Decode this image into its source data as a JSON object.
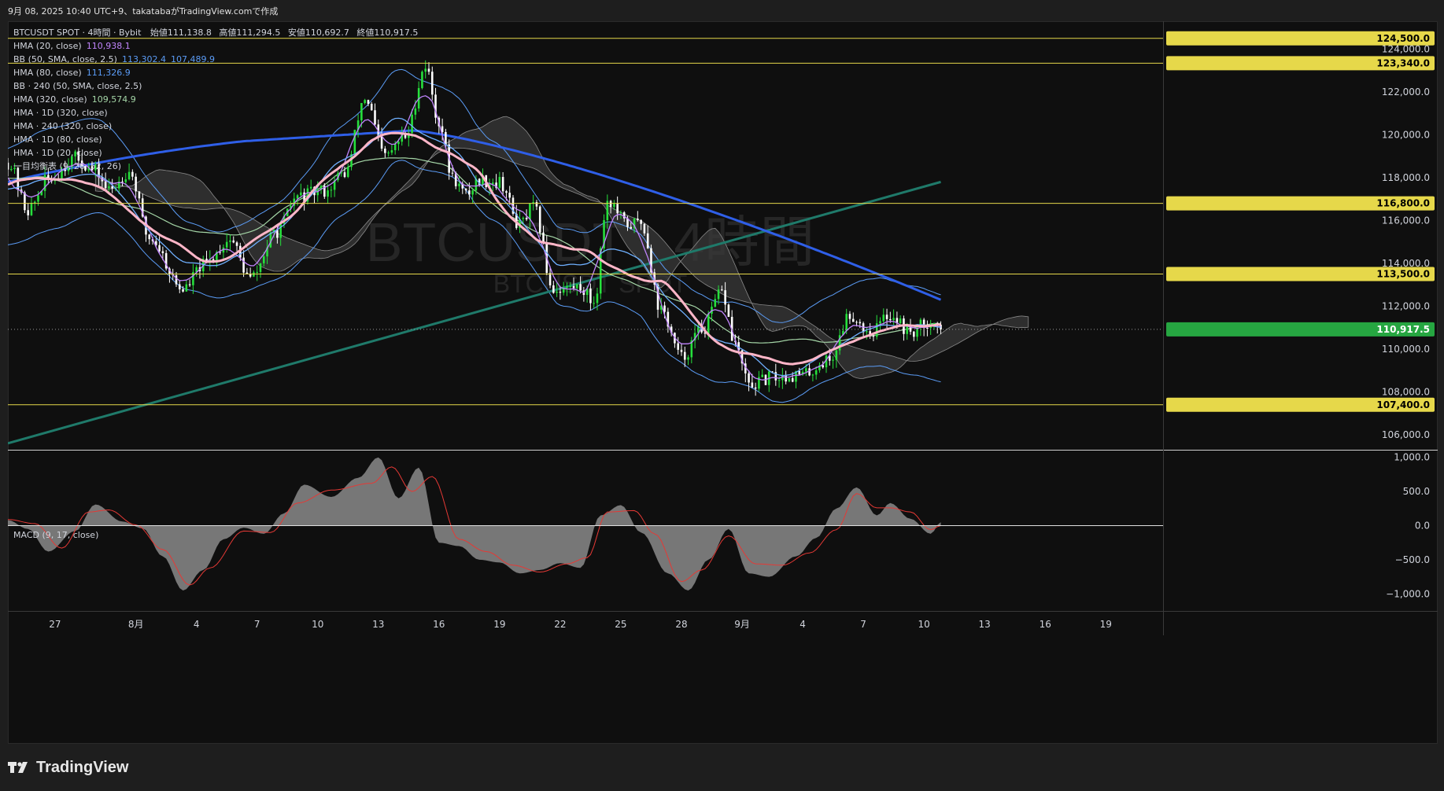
{
  "header": {
    "snapshot_text": "9月 08, 2025 10:40 UTC+9、takatabaがTradingView.comで作成",
    "symbol_line": {
      "symbol": "BTCUSDT SPOT · 4時間 · Bybit",
      "open_label": "始値",
      "open": "111,138.8",
      "high_label": "高値",
      "high": "111,294.5",
      "low_label": "安値",
      "low": "110,692.7",
      "close_label": "終値",
      "close": "110,917.5"
    }
  },
  "watermark": {
    "main": "BTCUSDT · 4時間",
    "sub": "BTCUSDT SPOT"
  },
  "indicators": [
    {
      "name": "HMA (20, close)",
      "value": "110,938.1",
      "value_color": "#c084fc"
    },
    {
      "name": "BB (50, SMA, close, 2.5)",
      "value": "113,302.4",
      "value2": "107,489.9",
      "value_color": "#5b9cf6"
    },
    {
      "name": "HMA (80, close)",
      "value": "111,326.9",
      "value_color": "#5b9cf6"
    },
    {
      "name": "BB · 240 (50, SMA, close, 2.5)",
      "value": "",
      "value_color": "#9e9e9e"
    },
    {
      "name": "HMA (320, close)",
      "value": "109,574.9",
      "value_color": "#a5d6a7"
    },
    {
      "name": "HMA · 1D (320, close)",
      "value": "",
      "value_color": "#9e9e9e"
    },
    {
      "name": "HMA · 240 (320, close)",
      "value": "",
      "value_color": "#9e9e9e"
    },
    {
      "name": "HMA · 1D (80, close)",
      "value": "",
      "value_color": "#9e9e9e"
    },
    {
      "name": "HMA · 1D (20, close)",
      "value": "",
      "value_color": "#9e9e9e"
    },
    {
      "name": "一目均衡表 (9, 26, 52, 26)",
      "value": "",
      "value_color": "#9e9e9e"
    }
  ],
  "macd_legend": "MACD (9, 17, close)",
  "footer": {
    "brand": "TradingView"
  },
  "colors": {
    "up": "#26e03c",
    "down": "#ffffff",
    "hline": "#e6d84a",
    "hma20": "#c084fc",
    "bb": "#5b9cf6",
    "hma80": "#6fb0ff",
    "hma320": "#a5d6a7",
    "hma1d80": "#2f5fe8",
    "hma240": "#ffb6c8",
    "trend": "#1f7a6a",
    "cloud": "#3a3a3a",
    "macd_hist": "#8a8a8a",
    "signal": "#e53935",
    "last_price_bg": "#26a641"
  },
  "chart_data": {
    "type": "candlestick",
    "title": "BTCUSDT SPOT · 4時間 · Bybit",
    "ylim": [
      105300,
      125300
    ],
    "yticks": [
      106000,
      108000,
      110000,
      112000,
      114000,
      116000,
      118000,
      120000,
      122000,
      124000
    ],
    "ytick_labels": [
      "106,000.0",
      "108,000.0",
      "110,000.0",
      "112,000.0",
      "114,000.0",
      "116,000.0",
      "118,000.0",
      "120,000.0",
      "122,000.0",
      "124,000.0"
    ],
    "horizontal_levels": [
      {
        "value": 124500,
        "label": "124,500.0"
      },
      {
        "value": 123340,
        "label": "123,340.0"
      },
      {
        "value": 116800,
        "label": "116,800.0"
      },
      {
        "value": 113500,
        "label": "113,500.0"
      },
      {
        "value": 107400,
        "label": "107,400.0"
      }
    ],
    "last_price": {
      "value": 110917.5,
      "label": "110,917.5"
    },
    "x_ticks": [
      {
        "label": "27",
        "bar": 14
      },
      {
        "label": "8月",
        "bar": 38
      },
      {
        "label": "4",
        "bar": 56
      },
      {
        "label": "7",
        "bar": 74
      },
      {
        "label": "10",
        "bar": 92
      },
      {
        "label": "13",
        "bar": 110
      },
      {
        "label": "16",
        "bar": 128
      },
      {
        "label": "19",
        "bar": 146
      },
      {
        "label": "22",
        "bar": 164
      },
      {
        "label": "25",
        "bar": 182
      },
      {
        "label": "28",
        "bar": 200
      },
      {
        "label": "9月",
        "bar": 218
      },
      {
        "label": "4",
        "bar": 236
      },
      {
        "label": "7",
        "bar": 254
      },
      {
        "label": "10",
        "bar": 272
      },
      {
        "label": "13",
        "bar": 290
      },
      {
        "label": "16",
        "bar": 308
      },
      {
        "label": "19",
        "bar": 326
      }
    ],
    "x_range": [
      0,
      343
    ],
    "close_anchors": [
      [
        0,
        118700
      ],
      [
        6,
        116500
      ],
      [
        12,
        117900
      ],
      [
        20,
        118900
      ],
      [
        26,
        118300
      ],
      [
        30,
        117400
      ],
      [
        36,
        118300
      ],
      [
        42,
        115200
      ],
      [
        52,
        112800
      ],
      [
        58,
        113900
      ],
      [
        66,
        115100
      ],
      [
        72,
        113300
      ],
      [
        80,
        115500
      ],
      [
        86,
        117100
      ],
      [
        94,
        117400
      ],
      [
        100,
        118200
      ],
      [
        106,
        121700
      ],
      [
        112,
        119000
      ],
      [
        118,
        119900
      ],
      [
        124,
        123200
      ],
      [
        128,
        120600
      ],
      [
        132,
        118000
      ],
      [
        136,
        117200
      ],
      [
        140,
        117900
      ],
      [
        146,
        117800
      ],
      [
        152,
        115800
      ],
      [
        156,
        116600
      ],
      [
        162,
        112800
      ],
      [
        170,
        112900
      ],
      [
        174,
        112200
      ],
      [
        178,
        116900
      ],
      [
        184,
        115800
      ],
      [
        188,
        115900
      ],
      [
        194,
        111800
      ],
      [
        200,
        109600
      ],
      [
        206,
        110900
      ],
      [
        212,
        112600
      ],
      [
        216,
        110200
      ],
      [
        220,
        108300
      ],
      [
        228,
        108700
      ],
      [
        236,
        108800
      ],
      [
        244,
        109500
      ],
      [
        250,
        111600
      ],
      [
        256,
        110800
      ],
      [
        262,
        111600
      ],
      [
        268,
        110800
      ],
      [
        274,
        111300
      ],
      [
        277,
        110917.5
      ]
    ],
    "macd": {
      "ylim": [
        -1250,
        1100
      ],
      "yticks": [
        1000,
        500,
        0,
        -500,
        -1000
      ],
      "ytick_labels": [
        "1,000.0",
        "500.0",
        "0.0",
        "−500.0",
        "−1,000.0"
      ],
      "hist_anchors": [
        [
          0,
          80
        ],
        [
          6,
          -50
        ],
        [
          12,
          -380
        ],
        [
          20,
          -80
        ],
        [
          26,
          310
        ],
        [
          34,
          60
        ],
        [
          40,
          -40
        ],
        [
          46,
          -450
        ],
        [
          52,
          -950
        ],
        [
          58,
          -650
        ],
        [
          64,
          -200
        ],
        [
          70,
          -30
        ],
        [
          76,
          -120
        ],
        [
          82,
          180
        ],
        [
          88,
          600
        ],
        [
          96,
          420
        ],
        [
          104,
          700
        ],
        [
          110,
          1000
        ],
        [
          116,
          400
        ],
        [
          122,
          850
        ],
        [
          128,
          -250
        ],
        [
          134,
          -300
        ],
        [
          140,
          -500
        ],
        [
          146,
          -540
        ],
        [
          152,
          -700
        ],
        [
          158,
          -650
        ],
        [
          164,
          -550
        ],
        [
          170,
          -620
        ],
        [
          176,
          150
        ],
        [
          182,
          300
        ],
        [
          188,
          -100
        ],
        [
          196,
          -700
        ],
        [
          202,
          -950
        ],
        [
          208,
          -500
        ],
        [
          214,
          -50
        ],
        [
          220,
          -700
        ],
        [
          226,
          -750
        ],
        [
          234,
          -450
        ],
        [
          240,
          -180
        ],
        [
          246,
          250
        ],
        [
          252,
          560
        ],
        [
          258,
          150
        ],
        [
          262,
          330
        ],
        [
          268,
          100
        ],
        [
          274,
          -120
        ],
        [
          277,
          50
        ]
      ],
      "signal_anchors": [
        [
          0,
          90
        ],
        [
          8,
          30
        ],
        [
          16,
          -330
        ],
        [
          24,
          200
        ],
        [
          30,
          230
        ],
        [
          38,
          10
        ],
        [
          46,
          -350
        ],
        [
          54,
          -870
        ],
        [
          60,
          -620
        ],
        [
          70,
          -80
        ],
        [
          78,
          -100
        ],
        [
          86,
          330
        ],
        [
          96,
          520
        ],
        [
          108,
          620
        ],
        [
          114,
          860
        ],
        [
          120,
          500
        ],
        [
          126,
          720
        ],
        [
          134,
          -200
        ],
        [
          142,
          -380
        ],
        [
          150,
          -580
        ],
        [
          158,
          -680
        ],
        [
          166,
          -560
        ],
        [
          172,
          -470
        ],
        [
          178,
          200
        ],
        [
          186,
          220
        ],
        [
          192,
          -120
        ],
        [
          200,
          -820
        ],
        [
          206,
          -650
        ],
        [
          214,
          -150
        ],
        [
          222,
          -560
        ],
        [
          230,
          -580
        ],
        [
          238,
          -400
        ],
        [
          246,
          -60
        ],
        [
          252,
          470
        ],
        [
          258,
          260
        ],
        [
          262,
          260
        ],
        [
          268,
          200
        ],
        [
          274,
          -60
        ],
        [
          277,
          0
        ]
      ]
    }
  }
}
